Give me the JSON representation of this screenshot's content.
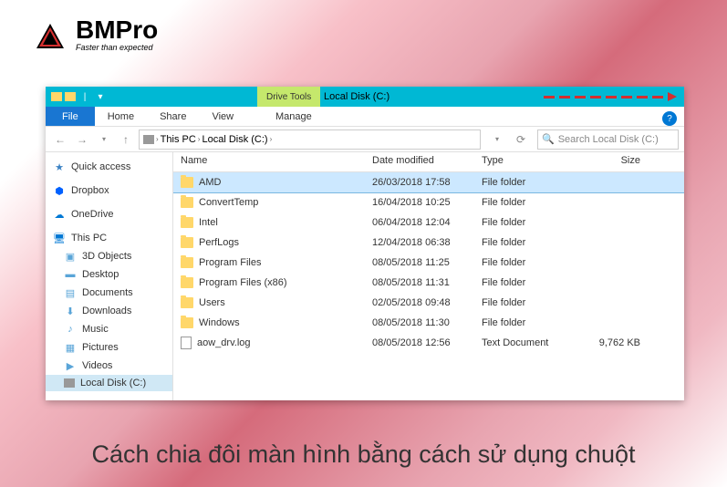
{
  "logo": {
    "brand": "BMPro",
    "tagline": "Faster than expected"
  },
  "titlebar": {
    "drive_tools": "Drive Tools",
    "title": "Local Disk (C:)"
  },
  "ribbon": {
    "file": "File",
    "home": "Home",
    "share": "Share",
    "view": "View",
    "manage": "Manage"
  },
  "address": {
    "segments": [
      "This PC",
      "Local Disk (C:)"
    ],
    "search_placeholder": "Search Local Disk (C:)"
  },
  "sidebar": {
    "quick_access": "Quick access",
    "dropbox": "Dropbox",
    "onedrive": "OneDrive",
    "this_pc": "This PC",
    "items": [
      "3D Objects",
      "Desktop",
      "Documents",
      "Downloads",
      "Music",
      "Pictures",
      "Videos",
      "Local Disk (C:)"
    ]
  },
  "columns": {
    "name": "Name",
    "date": "Date modified",
    "type": "Type",
    "size": "Size"
  },
  "files": [
    {
      "name": "AMD",
      "date": "26/03/2018 17:58",
      "type": "File folder",
      "size": "",
      "icon": "folder",
      "selected": true
    },
    {
      "name": "ConvertTemp",
      "date": "16/04/2018 10:25",
      "type": "File folder",
      "size": "",
      "icon": "folder"
    },
    {
      "name": "Intel",
      "date": "06/04/2018 12:04",
      "type": "File folder",
      "size": "",
      "icon": "folder"
    },
    {
      "name": "PerfLogs",
      "date": "12/04/2018 06:38",
      "type": "File folder",
      "size": "",
      "icon": "folder"
    },
    {
      "name": "Program Files",
      "date": "08/05/2018 11:25",
      "type": "File folder",
      "size": "",
      "icon": "folder"
    },
    {
      "name": "Program Files (x86)",
      "date": "08/05/2018 11:31",
      "type": "File folder",
      "size": "",
      "icon": "folder"
    },
    {
      "name": "Users",
      "date": "02/05/2018 09:48",
      "type": "File folder",
      "size": "",
      "icon": "folder"
    },
    {
      "name": "Windows",
      "date": "08/05/2018 11:30",
      "type": "File folder",
      "size": "",
      "icon": "folder"
    },
    {
      "name": "aow_drv.log",
      "date": "08/05/2018 12:56",
      "type": "Text Document",
      "size": "9,762 KB",
      "icon": "file"
    }
  ],
  "caption": "Cách chia đôi màn hình bằng cách sử dụng chuột"
}
